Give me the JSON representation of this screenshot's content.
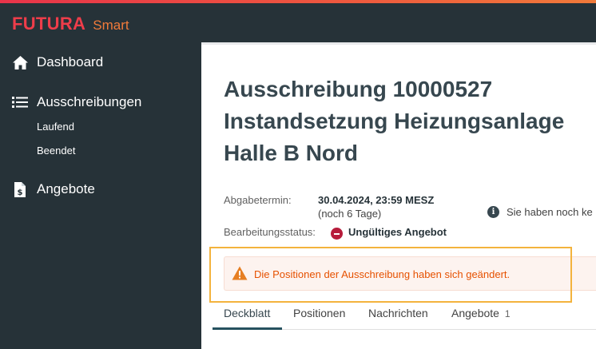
{
  "brand": {
    "name": "FUTURA",
    "product": "Smart"
  },
  "sidebar": {
    "items": [
      {
        "label": "Dashboard",
        "icon": "home-icon"
      },
      {
        "label": "Ausschreibungen",
        "icon": "list-icon",
        "children": [
          {
            "label": "Laufend"
          },
          {
            "label": "Beendet"
          }
        ]
      },
      {
        "label": "Angebote",
        "icon": "invoice-icon"
      }
    ]
  },
  "main": {
    "title": "Ausschreibung 10000527 Instandsetzung Heizungsanlage Halle B Nord",
    "deadline": {
      "label": "Abgabetermin:",
      "value": "30.04.2024, 23:59 MESZ",
      "remaining": "(noch 6 Tage)"
    },
    "status": {
      "label": "Bearbeitungsstatus:",
      "value": "Ungültiges Angebot",
      "color": "#b71c3b"
    },
    "info_text": "Sie haben noch ke",
    "warning": {
      "text": "Die Positionen der Ausschreibung haben sich geändert.",
      "color": "#e65100"
    },
    "tabs": [
      {
        "label": "Deckblatt",
        "active": true
      },
      {
        "label": "Positionen"
      },
      {
        "label": "Nachrichten"
      },
      {
        "label": "Angebote",
        "badge": "1"
      }
    ]
  },
  "colors": {
    "sidebar": "#263238",
    "accent": "#ee3d4a",
    "warning_frame": "#f3b33d"
  }
}
